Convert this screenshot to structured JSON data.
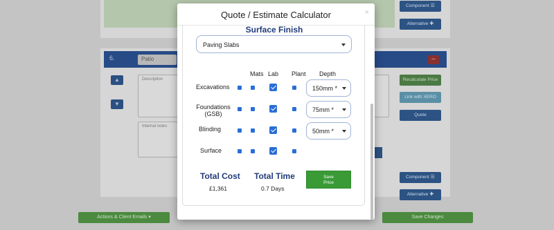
{
  "background": {
    "item_number": "6.",
    "item_name": "Patio",
    "description_placeholder": "Description",
    "notes_placeholder": "Internal notes",
    "buttons": {
      "component": "Component",
      "alternative": "Alternative",
      "recalculate": "Recalculate Price",
      "link_xero": "Link with XERO",
      "quote": "Quote",
      "actions_emails": "Actions & Client Emails",
      "save_changes": "Save Changes"
    }
  },
  "modal": {
    "title": "Quote / Estimate Calculator",
    "close_glyph": "×",
    "section_title": "Surface Finish",
    "surface_finish_value": "Paving Slabs",
    "columns": [
      "Mats",
      "Lab",
      "Plant",
      "Depth"
    ],
    "rows": [
      {
        "label": "Excavations",
        "depth": "150mm *"
      },
      {
        "label": "Foundations (GSB)",
        "depth": "75mm *"
      },
      {
        "label": "Blinding",
        "depth": "50mm *"
      },
      {
        "label": "Surface",
        "depth": ""
      }
    ],
    "total_cost_label": "Total Cost",
    "total_cost_value": "£1,361",
    "total_time_label": "Total Time",
    "total_time_value": "0.7 Days",
    "save_price_label": "Save Price"
  },
  "colors": {
    "title_blue": "#213a7a",
    "checkbox_blue": "#2a6ed6",
    "save_green": "#3a9a36"
  }
}
